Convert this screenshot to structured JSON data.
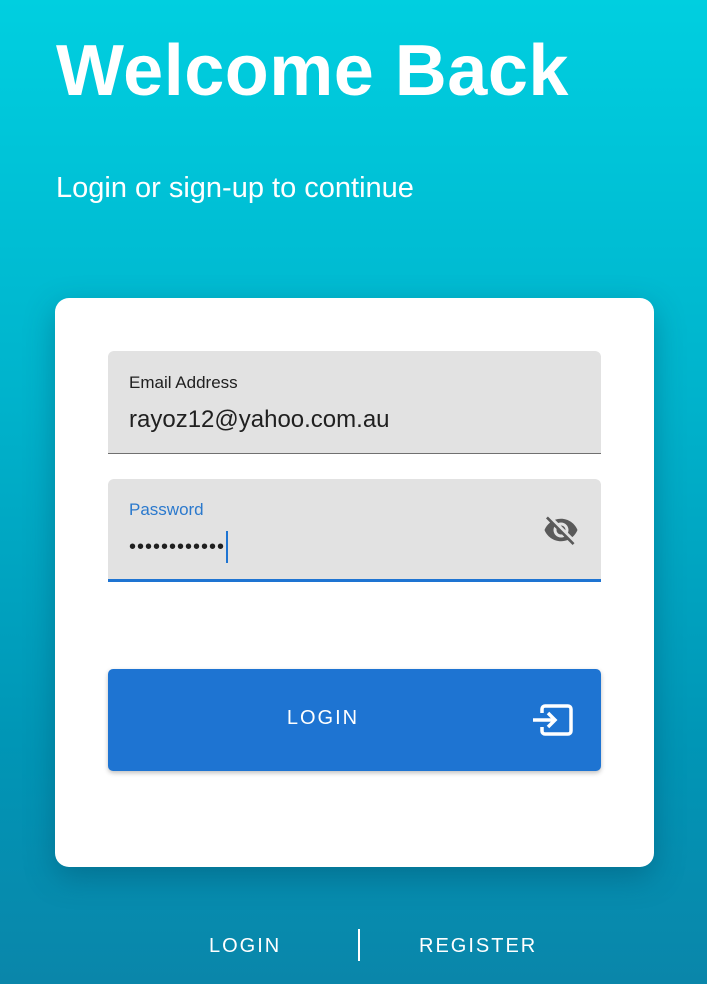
{
  "header": {
    "title": "Welcome Back",
    "subtitle": "Login or sign-up to continue"
  },
  "form": {
    "email": {
      "label": "Email Address",
      "value": "rayoz12@yahoo.com.au"
    },
    "password": {
      "label": "Password",
      "value": "••••••••••••",
      "toggle_icon": "eye-off-icon"
    },
    "login_button": {
      "label": "LOGIN",
      "icon": "login-icon"
    }
  },
  "bottom_nav": {
    "items": [
      {
        "label": "LOGIN"
      },
      {
        "label": "REGISTER"
      }
    ]
  },
  "colors": {
    "background_top": "#00cfe0",
    "background_bottom": "#0a86aa",
    "accent": "#1e74d2",
    "field_background": "#e2e2e2",
    "card": "#ffffff"
  }
}
